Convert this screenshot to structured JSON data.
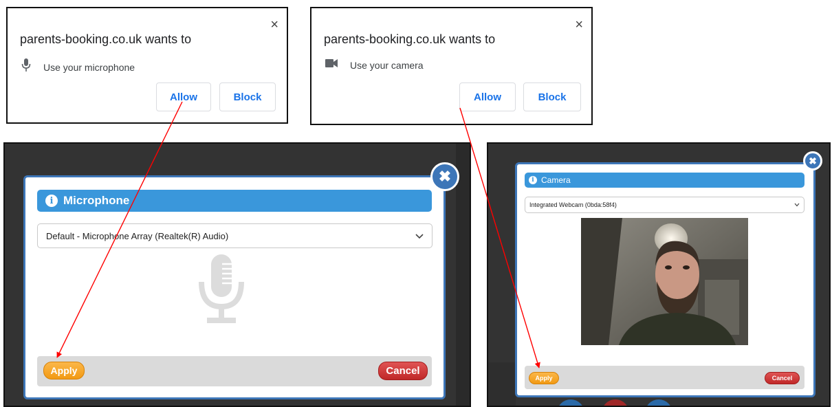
{
  "mic_prompt": {
    "title": "parents-booking.co.uk wants to",
    "permission": "Use your microphone",
    "allow": "Allow",
    "block": "Block",
    "close": "×",
    "icon": "microphone-icon"
  },
  "cam_prompt": {
    "title": "parents-booking.co.uk wants to",
    "permission": "Use your camera",
    "allow": "Allow",
    "block": "Block",
    "close": "×",
    "icon": "camera-icon"
  },
  "mic_modal": {
    "header": "Microphone",
    "device": "Default - Microphone Array (Realtek(R) Audio)",
    "apply": "Apply",
    "cancel": "Cancel"
  },
  "cam_modal": {
    "header": "Camera",
    "device": "Integrated Webcam (0bda:58f4)",
    "apply": "Apply",
    "cancel": "Cancel"
  },
  "colors": {
    "accent": "#1a73e8",
    "header": "#3a97db",
    "modal_border": "#3d76b8",
    "apply": "#f29a13",
    "cancel": "#c02828",
    "arrow": "#ff0000"
  }
}
